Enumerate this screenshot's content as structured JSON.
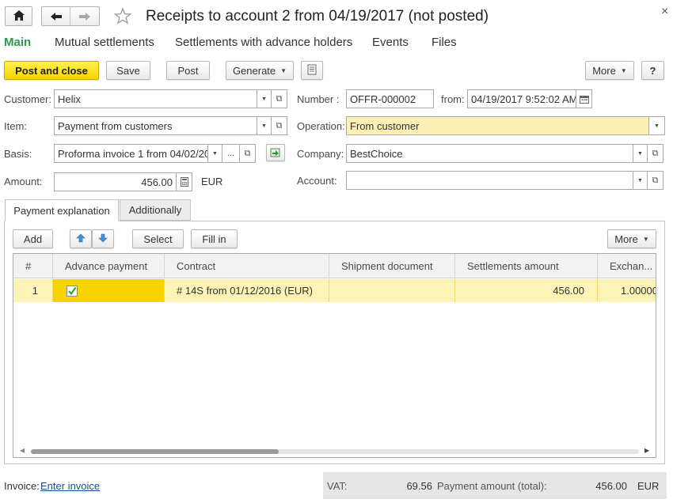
{
  "window": {
    "title": "Receipts to account 2 from 04/19/2017 (not posted)",
    "close_glyph": "×"
  },
  "nav_tabs": [
    {
      "label": "Main",
      "active": true
    },
    {
      "label": "Mutual settlements"
    },
    {
      "label": "Settlements with advance holders"
    },
    {
      "label": "Events"
    },
    {
      "label": "Files"
    }
  ],
  "toolbar": {
    "post_close_label": "Post and close",
    "save_label": "Save",
    "post_label": "Post",
    "generate_label": "Generate",
    "more_label": "More",
    "help_label": "?"
  },
  "form": {
    "customer_label": "Customer:",
    "customer_value": "Helix",
    "item_label": "Item:",
    "item_value": "Payment from customers",
    "basis_label": "Basis:",
    "basis_value": "Proforma invoice 1 from 04/02/20",
    "basis_more": "...",
    "amount_label": "Amount:",
    "amount_value": "456.00",
    "currency": "EUR",
    "number_label": "Number :",
    "number_value": "OFFR-000002",
    "from_label": "from:",
    "date_value": "04/19/2017  9:52:02 AM",
    "operation_label": "Operation:",
    "operation_value": "From customer",
    "company_label": "Company:",
    "company_value": "BestChoice",
    "account_label": "Account:",
    "account_value": ""
  },
  "inner_tabs": [
    {
      "label": "Payment explanation",
      "active": true
    },
    {
      "label": "Additionally"
    }
  ],
  "table_toolbar": {
    "add_label": "Add",
    "select_label": "Select",
    "fill_in_label": "Fill in",
    "more_label": "More"
  },
  "table": {
    "columns": [
      "#",
      "Advance payment",
      "Contract",
      "Shipment document",
      "Settlements amount",
      "Exchan..."
    ],
    "rows": [
      {
        "num": "1",
        "advance": true,
        "contract": "# 14S from 01/12/2016 (EUR)",
        "shipment": "",
        "amount": "456.00",
        "exchange": "1.00000"
      }
    ]
  },
  "footer": {
    "invoice_label": "Invoice:",
    "invoice_link": "Enter invoice",
    "vat_label": "VAT:",
    "vat_value": "69.56",
    "payment_label": "Payment amount (total):",
    "payment_value": "456.00",
    "payment_currency": "EUR"
  },
  "colors": {
    "active_tab": "#2e9a4a",
    "primary_button": "#f6d400",
    "highlight_field": "#fdf0b6",
    "selected_row": "#fdf3b6",
    "link": "#1a4c8f",
    "arrow_icons": "#3f8fd8"
  }
}
